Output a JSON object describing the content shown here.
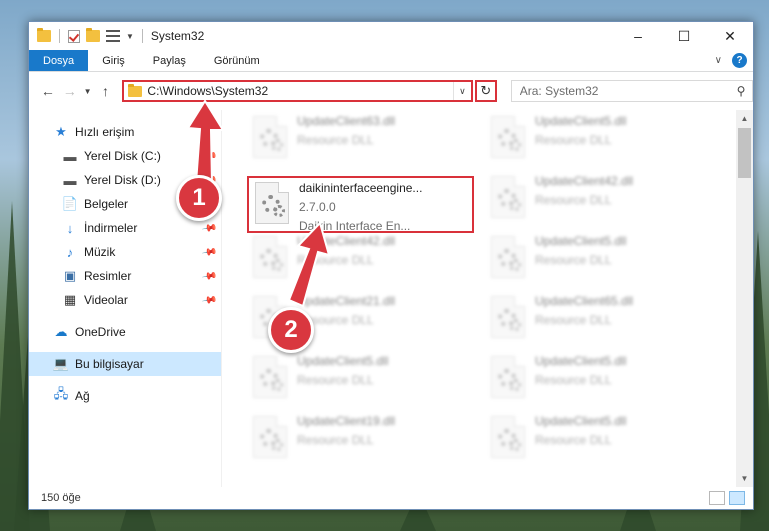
{
  "window": {
    "title": "System32"
  },
  "ribbon": {
    "tabs": [
      "Dosya",
      "Giriş",
      "Paylaş",
      "Görünüm"
    ]
  },
  "nav": {
    "address": "C:\\Windows\\System32",
    "search_placeholder": "Ara: System32"
  },
  "sidebar": {
    "quick_access": "Hızlı erişim",
    "items": [
      {
        "label": "Yerel Disk (C:)",
        "icon": "drive-icon"
      },
      {
        "label": "Yerel Disk (D:)",
        "icon": "drive-icon"
      },
      {
        "label": "Belgeler",
        "icon": "documents-icon"
      },
      {
        "label": "İndirmeler",
        "icon": "download-icon"
      },
      {
        "label": "Müzik",
        "icon": "music-icon"
      },
      {
        "label": "Resimler",
        "icon": "pictures-icon"
      },
      {
        "label": "Videolar",
        "icon": "videos-icon"
      }
    ],
    "onedrive": "OneDrive",
    "this_pc": "Bu bilgisayar",
    "network": "Ağ"
  },
  "files": [
    {
      "name": "UpdateClient63.dll",
      "desc": "Resource DLL"
    },
    {
      "name": "UpdateClient5.dll",
      "desc": "Resource DLL"
    },
    {
      "name": "daikininterfaceengine...",
      "version": "2.7.0.0",
      "desc": "Daikin Interface En..."
    },
    {
      "name": "UpdateClient42.dll",
      "desc": "Resource DLL"
    },
    {
      "name": "UpdateClient42.dll",
      "desc": "Resource DLL"
    },
    {
      "name": "UpdateClient5.dll",
      "desc": "Resource DLL"
    },
    {
      "name": "UpdateClient21.dll",
      "desc": "Resource DLL"
    },
    {
      "name": "UpdateClient65.dll",
      "desc": "Resource DLL"
    },
    {
      "name": "UpdateClient5.dll",
      "desc": "Resource DLL"
    },
    {
      "name": "UpdateClient5.dll",
      "desc": "Resource DLL"
    },
    {
      "name": "UpdateClient19.dll",
      "desc": "Resource DLL"
    },
    {
      "name": "UpdateClient5.dll",
      "desc": "Resource DLL"
    }
  ],
  "status": {
    "count": "150 öğe"
  },
  "annotations": {
    "step1": "1",
    "step2": "2"
  },
  "colors": {
    "accent": "#1979ca",
    "highlight": "#d9313a",
    "selected": "#cce8ff"
  }
}
